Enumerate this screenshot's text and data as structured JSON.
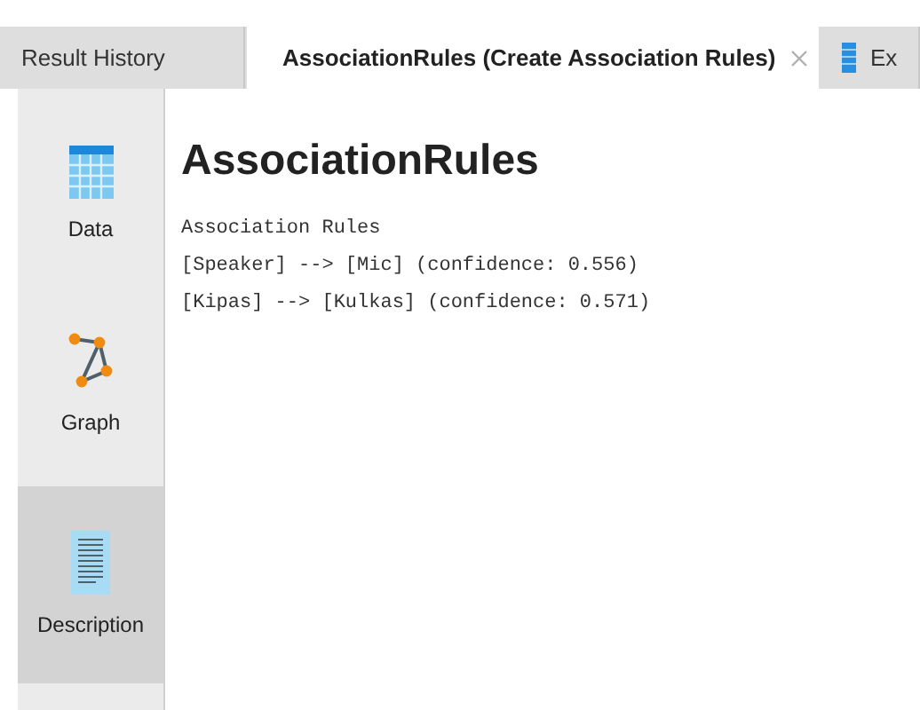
{
  "tabs": [
    {
      "label": "Result History",
      "selected": false
    },
    {
      "label": "AssociationRules (Create Association Rules)",
      "selected": true
    },
    {
      "label": "Ex",
      "selected": false
    }
  ],
  "sidebar": {
    "items": [
      {
        "label": "Data",
        "selected": false
      },
      {
        "label": "Graph",
        "selected": false
      },
      {
        "label": "Description",
        "selected": true
      }
    ]
  },
  "content": {
    "title": "AssociationRules",
    "lines": [
      "Association Rules",
      "[Speaker] --> [Mic] (confidence: 0.556)",
      "[Kipas] --> [Kulkas] (confidence: 0.571)"
    ]
  }
}
